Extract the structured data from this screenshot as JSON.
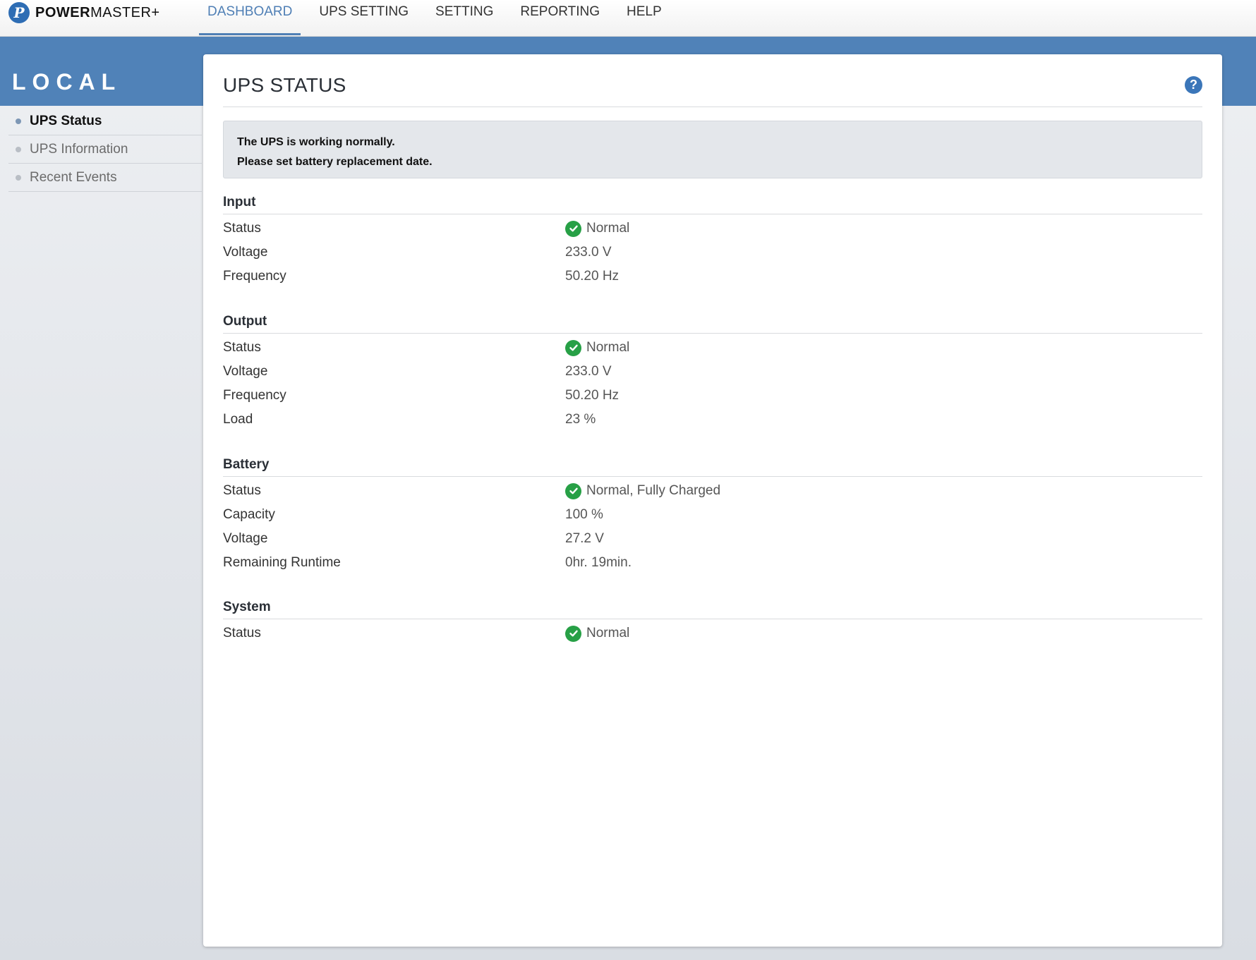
{
  "brand": {
    "mark": "P",
    "bold": "POWER",
    "light": "MASTER+"
  },
  "nav": {
    "items": [
      {
        "label": "DASHBOARD"
      },
      {
        "label": "UPS SETTING"
      },
      {
        "label": "SETTING"
      },
      {
        "label": "REPORTING"
      },
      {
        "label": "HELP"
      }
    ],
    "active": "DASHBOARD"
  },
  "sidebar": {
    "title": "LOCAL",
    "items": [
      {
        "label": "UPS Status"
      },
      {
        "label": "UPS Information"
      },
      {
        "label": "Recent Events"
      }
    ],
    "active": "UPS Status"
  },
  "main": {
    "title": "UPS STATUS",
    "help_icon": "?",
    "notice": {
      "line1": "The UPS is working normally.",
      "line2": "Please set battery replacement date."
    },
    "sections": [
      {
        "title": "Input",
        "rows": [
          {
            "label": "Status",
            "value": "Normal",
            "icon": "check-icon"
          },
          {
            "label": "Voltage",
            "value": "233.0 V"
          },
          {
            "label": "Frequency",
            "value": "50.20 Hz"
          }
        ]
      },
      {
        "title": "Output",
        "rows": [
          {
            "label": "Status",
            "value": "Normal",
            "icon": "check-icon"
          },
          {
            "label": "Voltage",
            "value": "233.0 V"
          },
          {
            "label": "Frequency",
            "value": "50.20 Hz"
          },
          {
            "label": "Load",
            "value": "23 %"
          }
        ]
      },
      {
        "title": "Battery",
        "rows": [
          {
            "label": "Status",
            "value": "Normal, Fully Charged",
            "icon": "check-icon"
          },
          {
            "label": "Capacity",
            "value": "100 %"
          },
          {
            "label": "Voltage",
            "value": "27.2 V"
          },
          {
            "label": "Remaining Runtime",
            "value": "0hr. 19min."
          }
        ]
      },
      {
        "title": "System",
        "rows": [
          {
            "label": "Status",
            "value": "Normal",
            "icon": "check-icon"
          }
        ]
      }
    ]
  },
  "colors": {
    "accent": "#5082b8",
    "nav_active": "#4f7fb5",
    "status_ok": "#27a046"
  }
}
